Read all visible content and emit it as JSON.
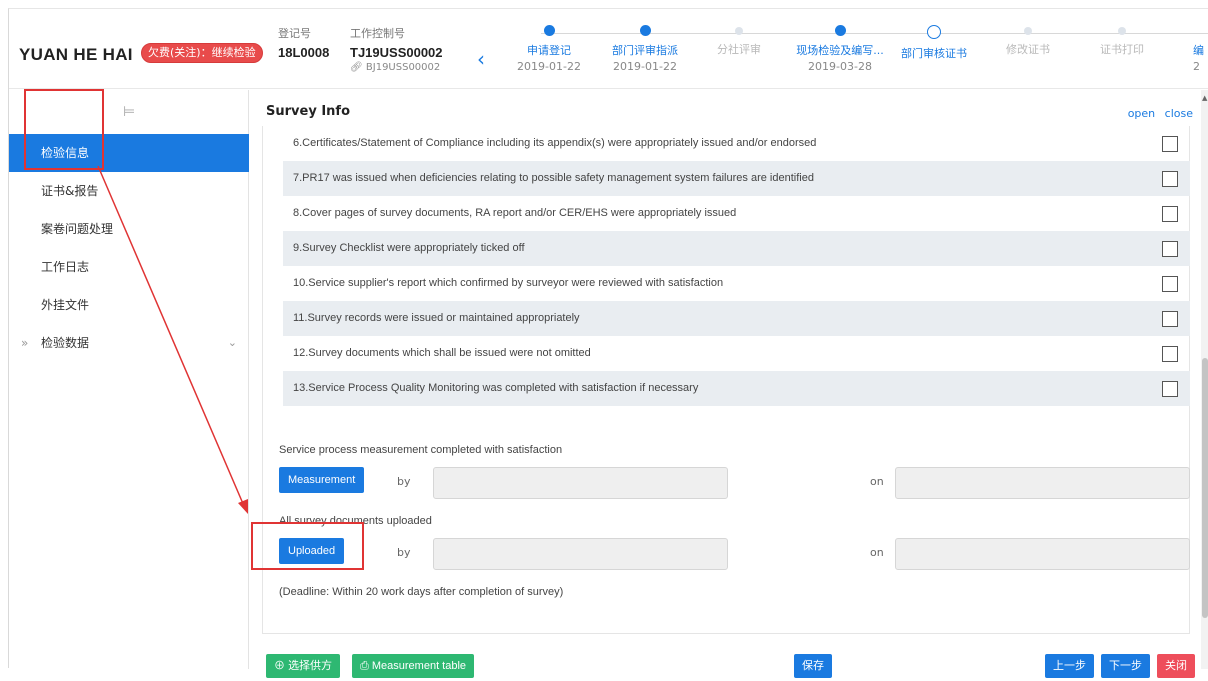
{
  "header": {
    "vessel_name": "YUAN HE HAI",
    "status_badge": "欠费(关注)：继续检验",
    "reg_no_label": "登记号",
    "reg_no": "18L0008",
    "control_no_label": "工作控制号",
    "control_no": "TJ19USS00002",
    "control_sub": "BJ19USS00002",
    "back_icon": "chevron-left-icon",
    "steps": [
      {
        "name": "申请登记",
        "date": "2019-01-22",
        "state": "done"
      },
      {
        "name": "部门评审指派",
        "date": "2019-01-22",
        "state": "done"
      },
      {
        "name": "分社评审",
        "date": "",
        "state": "todo"
      },
      {
        "name": "现场检验及编写...",
        "date": "2019-03-28",
        "state": "done"
      },
      {
        "name": "部门审核证书",
        "date": "",
        "state": "current"
      },
      {
        "name": "修改证书",
        "date": "",
        "state": "todo"
      },
      {
        "name": "证书打印",
        "date": "",
        "state": "todo"
      },
      {
        "name": "编",
        "date": "2",
        "state": "done"
      }
    ]
  },
  "sidebar": {
    "collapse_icon": "menu-collapse-icon",
    "items": [
      {
        "label": "检验信息",
        "active": true
      },
      {
        "label": "证书&报告"
      },
      {
        "label": "案卷问题处理"
      },
      {
        "label": "工作日志"
      },
      {
        "label": "外挂文件"
      },
      {
        "label": "检验数据",
        "prefix": "»",
        "chevron": "⌄"
      }
    ]
  },
  "main": {
    "title": "Survey Info",
    "open_label": "open",
    "close_label": "close",
    "checklist": [
      "6.Certificates/Statement of Compliance including its appendix(s) were appropriately issued and/or endorsed",
      "7.PR17 was issued when deficiencies relating to possible safety management system failures are identified",
      "8.Cover pages of survey documents, RA report and/or CER/EHS were appropriately issued",
      "9.Survey Checklist were appropriately ticked off",
      "10.Service supplier's report which confirmed by surveyor were reviewed with satisfaction",
      "11.Survey records were issued or maintained appropriately",
      "12.Survey documents which shall be issued were not omitted",
      "13.Service Process Quality Monitoring was completed with satisfaction if necessary"
    ],
    "measurement_section": "Service process measurement completed with satisfaction",
    "measurement_button": "Measurement",
    "uploaded_section": "All survey documents uploaded",
    "uploaded_button": "Uploaded",
    "by_label": "by",
    "on_label": "on",
    "deadline": "(Deadline: Within 20 work days after completion of survey)"
  },
  "footer": {
    "select_supplier": "选择供方",
    "measurement_table": "Measurement table",
    "save": "保存",
    "prev": "上一步",
    "next": "下一步",
    "close": "关闭"
  },
  "colors": {
    "accent": "#1a7ae0",
    "green": "#2eb872",
    "red": "#ee4e5b",
    "badge": "#e84b4b",
    "annotation": "#e03434"
  }
}
